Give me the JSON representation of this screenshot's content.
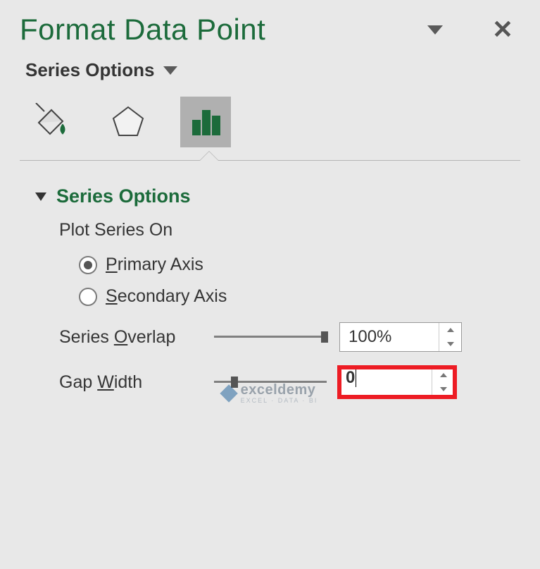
{
  "pane": {
    "title": "Format Data Point",
    "dropdown_label": "Series Options"
  },
  "tabs": {
    "fill": "fill-line",
    "effects": "effects",
    "series": "series-options",
    "active": "series"
  },
  "section": {
    "title": "Series Options",
    "plot_label": "Plot Series On",
    "radios": {
      "primary": {
        "text": "Primary Axis",
        "accel_index": 0,
        "checked": true
      },
      "secondary": {
        "text": "Secondary Axis",
        "accel_index": 0,
        "checked": false
      }
    },
    "overlap": {
      "label": "Series Overlap",
      "accel_char": "O",
      "value": "100%",
      "slider_pos_pct": 98
    },
    "gap": {
      "label": "Gap Width",
      "accel_char": "W",
      "value": "0",
      "slider_pos_pct": 18
    }
  },
  "watermark": {
    "brand": "exceldemy",
    "tag": "EXCEL · DATA · BI"
  }
}
